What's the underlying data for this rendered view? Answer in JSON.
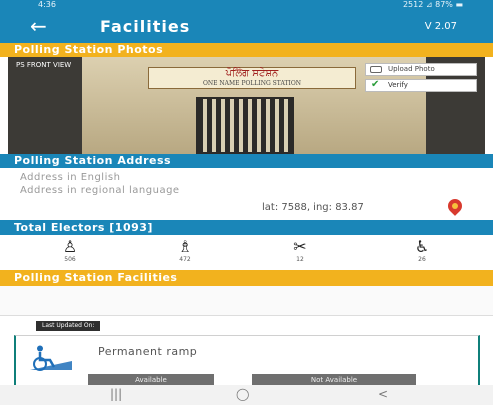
{
  "status": {
    "time": "4:36",
    "right": "2512 ⊿ 87% ▬"
  },
  "app_bar": {
    "back_icon": "back-arrow-icon",
    "title": "Facilities",
    "version": "V 2.07"
  },
  "photos_section": {
    "title": "Polling Station Photos",
    "caption": "PS FRONT VIEW",
    "sign_text": "ਪੋਲਿੰਗ ਸਟੇਸ਼ਨ",
    "sign_sub": "ONE NAME POLLING STATION",
    "upload_label": "Upload Photo",
    "verify_label": "Verify"
  },
  "address_section": {
    "title": "Polling Station Address",
    "address_english": "Address in English",
    "address_regional": "Address in regional language",
    "lat_lng": "lat: 7588, ing: 83.87"
  },
  "electors": {
    "title": "Total Electors [1093]",
    "items": [
      {
        "icon": "male-voter-icon",
        "count": "506"
      },
      {
        "icon": "female-voter-icon",
        "count": "472"
      },
      {
        "icon": "third-gender-icon",
        "count": "12"
      },
      {
        "icon": "wheelchair-icon",
        "count": "26"
      }
    ]
  },
  "facilities_section": {
    "title": "Polling Station Facilities",
    "last_updated": "Last Updated On:",
    "item_label": "Permanent ramp",
    "available_label": "Available",
    "not_available_label": "Not Available"
  },
  "nav": {
    "recent": "|||",
    "home": "◯",
    "back": "<"
  },
  "colors": {
    "primary": "#1a86b8",
    "accent": "#f2b21e",
    "teal": "#0f7f7a"
  }
}
